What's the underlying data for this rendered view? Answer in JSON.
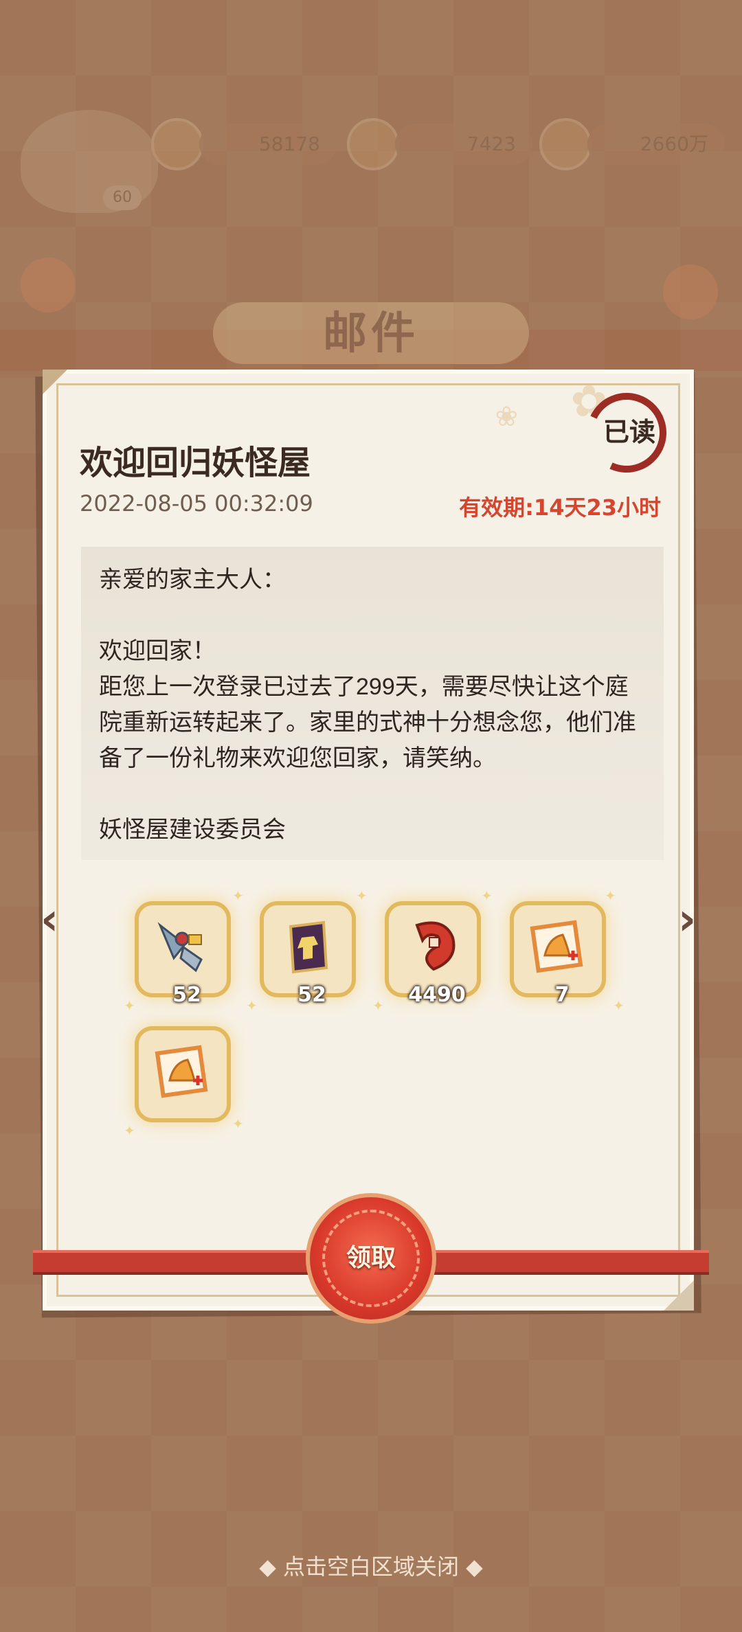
{
  "hud": {
    "player_level": "60",
    "currency_1": "58178",
    "currency_2": "7423",
    "currency_3": "2660万"
  },
  "screen": {
    "title": "邮件"
  },
  "mail": {
    "title": "欢迎回归妖怪屋",
    "date": "2022-08-05 00:32:09",
    "expiry": "有效期:14天23小时",
    "status": "已读",
    "body": "亲爱的家主大人：\n\n欢迎回家！\n距您上一次登录已过去了299天，需要尽快让这个庭院重新运转起来了。家里的式神十分想念您，他们准备了一份礼物来欢迎您回家，请笑纳。\n\n妖怪屋建设委员会"
  },
  "rewards": [
    {
      "icon": "bird-amulet-icon",
      "count": "52"
    },
    {
      "icon": "costume-scroll-icon",
      "count": "52"
    },
    {
      "icon": "red-token-icon",
      "count": "4490"
    },
    {
      "icon": "food-voucher-icon",
      "count": "7"
    },
    {
      "icon": "food-voucher-icon",
      "count": ""
    }
  ],
  "actions": {
    "claim": "领取",
    "close_hint": "◆ 点击空白区域关闭 ◆"
  },
  "colors": {
    "accent_red": "#d4462f",
    "paper": "#f6f1e6",
    "frame_gold": "#e3b95f"
  }
}
